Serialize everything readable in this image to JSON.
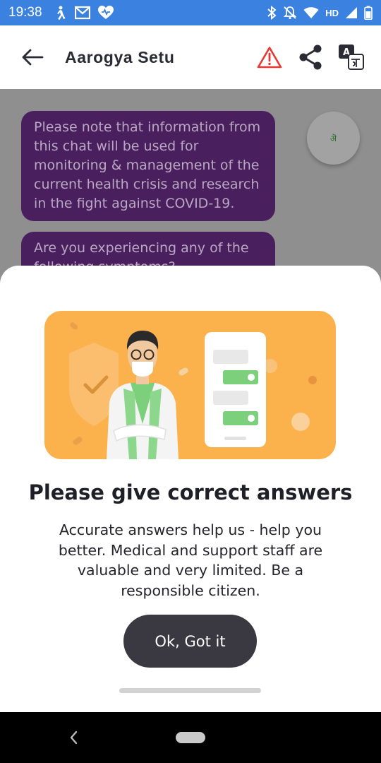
{
  "status_bar": {
    "time": "19:38",
    "network_label": "HD",
    "left_icons": [
      "person-walking-icon",
      "gmail-icon",
      "health-heart-icon"
    ],
    "right_icons": [
      "bluetooth-icon",
      "bell-off-icon",
      "wifi-icon",
      "signal-icon",
      "battery-icon"
    ]
  },
  "app_bar": {
    "title": "Aarogya Setu",
    "back_icon": "back-arrow-icon",
    "actions": [
      "warning-icon",
      "share-icon",
      "translate-icon"
    ],
    "accent_color": "#e53935"
  },
  "chat": {
    "messages": [
      "Please note that information from this chat will be used for monitoring & management of the current health crisis and research in the fight against COVID-19.",
      "Are you experiencing any of the following symptoms?"
    ],
    "bubble_color": "#4a1f5e",
    "fab_icon": "language-icon",
    "fab_glyph": "ऄ"
  },
  "sheet": {
    "illustration_icon": "doctor-chat-illustration",
    "title": "Please give correct answers",
    "body": "Accurate answers help us - help you better. Medical and support staff are valuable and very limited. Be a responsible citizen.",
    "button_label": "Ok, Got it",
    "illustration_color": "#fbb24c"
  },
  "nav_bar": {
    "back_icon": "nav-back-icon",
    "home_icon": "nav-home-pill"
  }
}
